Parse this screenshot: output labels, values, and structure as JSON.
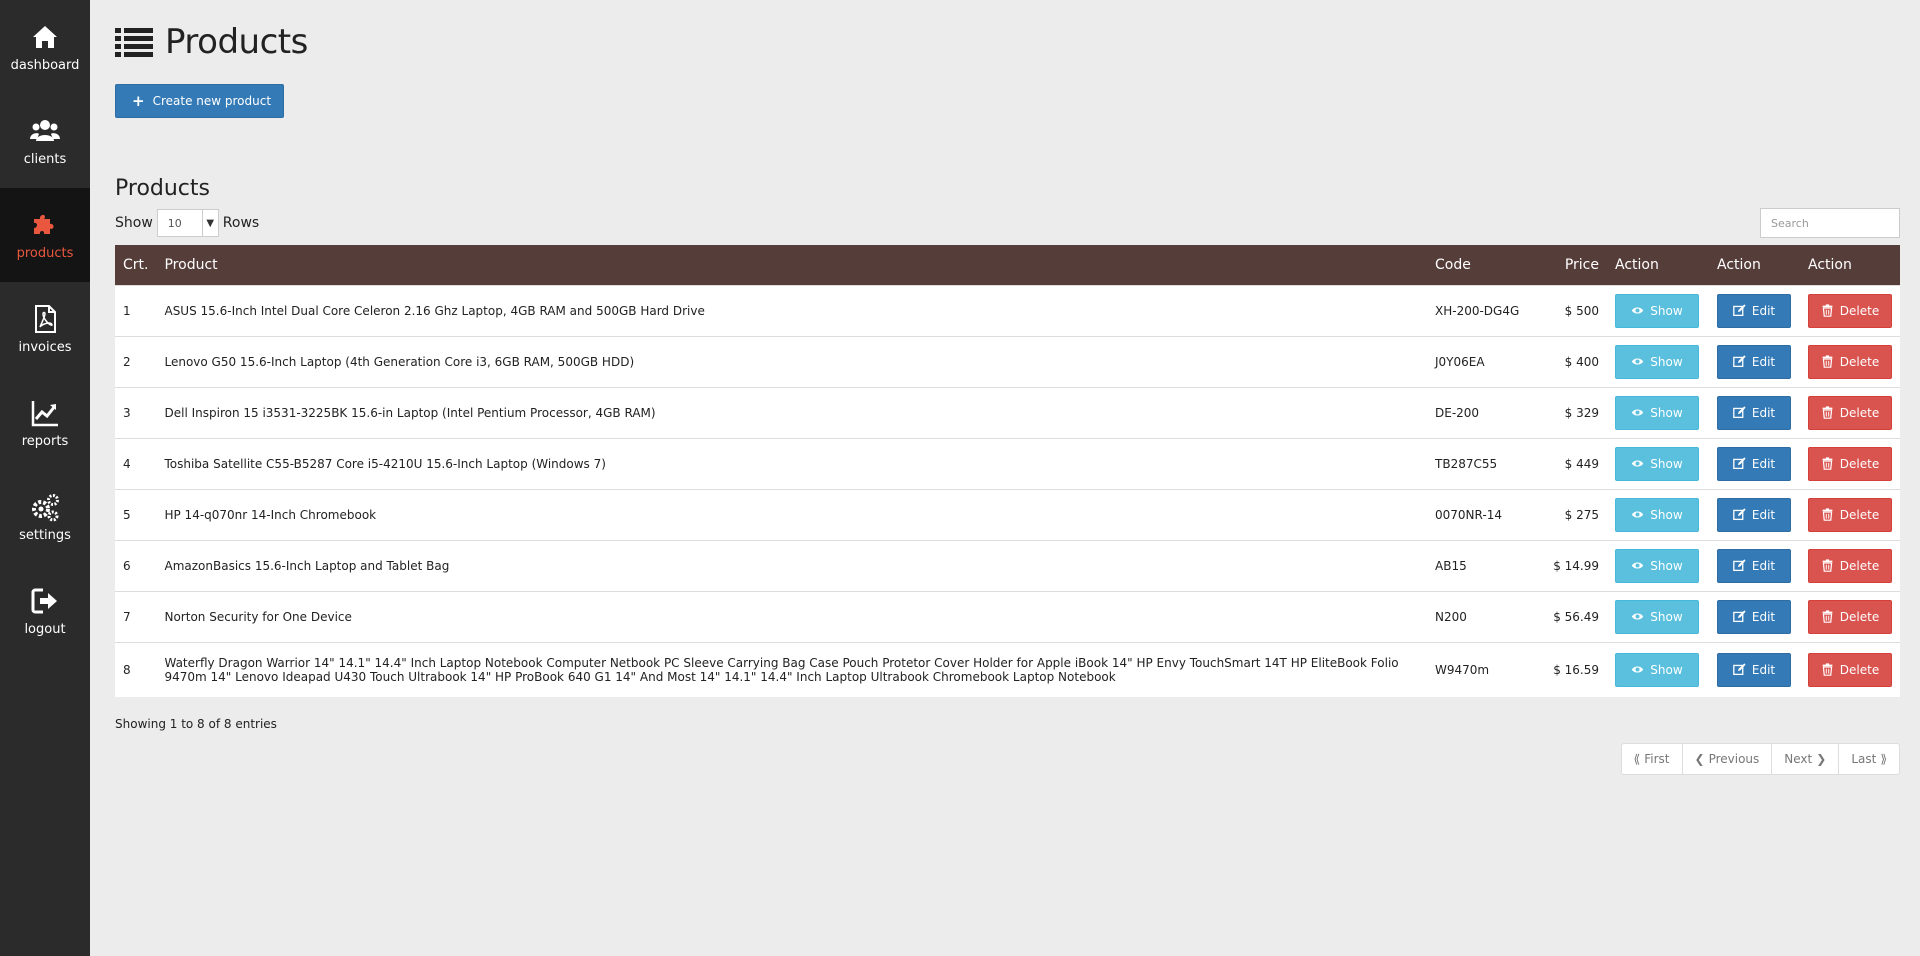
{
  "sidebar": {
    "items": [
      {
        "label": "dashboard",
        "icon": "home-icon"
      },
      {
        "label": "clients",
        "icon": "users-icon"
      },
      {
        "label": "products",
        "icon": "puzzle-icon",
        "active": true
      },
      {
        "label": "invoices",
        "icon": "pdf-file-icon"
      },
      {
        "label": "reports",
        "icon": "line-chart-icon"
      },
      {
        "label": "settings",
        "icon": "gears-icon"
      },
      {
        "label": "logout",
        "icon": "sign-out-icon"
      }
    ],
    "active_color": "#e9573f"
  },
  "header": {
    "title": "Products",
    "icon": "list-icon",
    "create_button": "Create new product"
  },
  "table_section": {
    "title": "Products",
    "show_label": "Show",
    "rows_value": "10",
    "rows_label": "Rows",
    "search_placeholder": "Search",
    "columns": [
      "Crt.",
      "Product",
      "Code",
      "Price",
      "Action",
      "Action",
      "Action"
    ],
    "rows": [
      {
        "crt": "1",
        "product": "ASUS 15.6-Inch Intel Dual Core Celeron 2.16 Ghz Laptop, 4GB RAM and 500GB Hard Drive",
        "code": "XH-200-DG4G",
        "price": "$ 500"
      },
      {
        "crt": "2",
        "product": "Lenovo G50 15.6-Inch Laptop (4th Generation Core i3, 6GB RAM, 500GB HDD)",
        "code": "J0Y06EA",
        "price": "$ 400"
      },
      {
        "crt": "3",
        "product": "Dell Inspiron 15 i3531-3225BK 15.6-in Laptop (Intel Pentium Processor, 4GB RAM)",
        "code": "DE-200",
        "price": "$ 329"
      },
      {
        "crt": "4",
        "product": "Toshiba Satellite C55-B5287 Core i5-4210U 15.6-Inch Laptop (Windows 7)",
        "code": "TB287C55",
        "price": "$ 449"
      },
      {
        "crt": "5",
        "product": "HP 14-q070nr 14-Inch Chromebook",
        "code": "0070NR-14",
        "price": "$ 275"
      },
      {
        "crt": "6",
        "product": "AmazonBasics 15.6-Inch Laptop and Tablet Bag",
        "code": "AB15",
        "price": "$ 14.99"
      },
      {
        "crt": "7",
        "product": "Norton Security for One Device",
        "code": "N200",
        "price": "$ 56.49"
      },
      {
        "crt": "8",
        "product": "Waterfly Dragon Warrior 14\" 14.1\" 14.4\" Inch Laptop Notebook Computer Netbook PC Sleeve Carrying Bag Case Pouch Protetor Cover Holder for Apple iBook 14\" HP Envy TouchSmart 14T HP EliteBook Folio 9470m 14\" Lenovo Ideapad U430 Touch Ultrabook 14\" HP ProBook 640 G1 14\" And Most 14\" 14.1\" 14.4\" Inch Laptop Ultrabook Chromebook Laptop Notebook",
        "code": "W9470m",
        "price": "$ 16.59"
      }
    ],
    "actions": {
      "show": "Show",
      "edit": "Edit",
      "delete": "Delete"
    },
    "info": "Showing 1 to 8 of 8 entries"
  },
  "pagination": {
    "first": "First",
    "previous": "Previous",
    "next": "Next",
    "last": "Last"
  }
}
